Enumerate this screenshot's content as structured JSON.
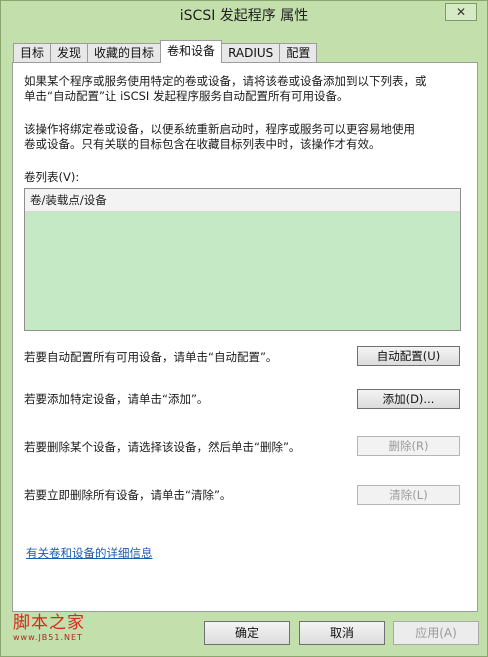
{
  "window": {
    "title": "iSCSI 发起程序 属性",
    "close_label": "✕"
  },
  "tabs": [
    {
      "label": "目标"
    },
    {
      "label": "发现"
    },
    {
      "label": "收藏的目标"
    },
    {
      "label": "卷和设备",
      "active": true
    },
    {
      "label": "RADIUS"
    },
    {
      "label": "配置"
    }
  ],
  "main": {
    "desc1_line1": "如果某个程序或服务使用特定的卷或设备，请将该卷或设备添加到以下列表，或",
    "desc1_line2": "单击“自动配置”让 iSCSI 发起程序服务自动配置所有可用设备。",
    "desc2_line1": "该操作将绑定卷或设备，以便系统重新启动时，程序或服务可以更容易地使用",
    "desc2_line2": "卷或设备。只有关联的目标包含在收藏目标列表中时，该操作才有效。",
    "list_label": "卷列表(V):",
    "list_header": "卷/装载点/设备",
    "auto_text": "若要自动配置所有可用设备，请单击“自动配置”。",
    "auto_button": "自动配置(U)",
    "add_text": "若要添加特定设备，请单击“添加”。",
    "add_button": "添加(D)...",
    "remove_text": "若要删除某个设备，请选择该设备，然后单击“删除”。",
    "remove_button": "删除(R)",
    "clear_text": "若要立即删除所有设备，请单击“清除”。",
    "clear_button": "清除(L)",
    "more_link": "有关卷和设备的详细信息"
  },
  "watermark": {
    "main": "脚本之家",
    "sub": "www.JB51.NET"
  },
  "footer": {
    "ok": "确定",
    "cancel": "取消",
    "apply": "应用(A)"
  },
  "colors": {
    "frame": "#c3dfac",
    "list_background": "#c6e9c5",
    "link": "#1a5bb0",
    "watermark": "#d4291c"
  }
}
